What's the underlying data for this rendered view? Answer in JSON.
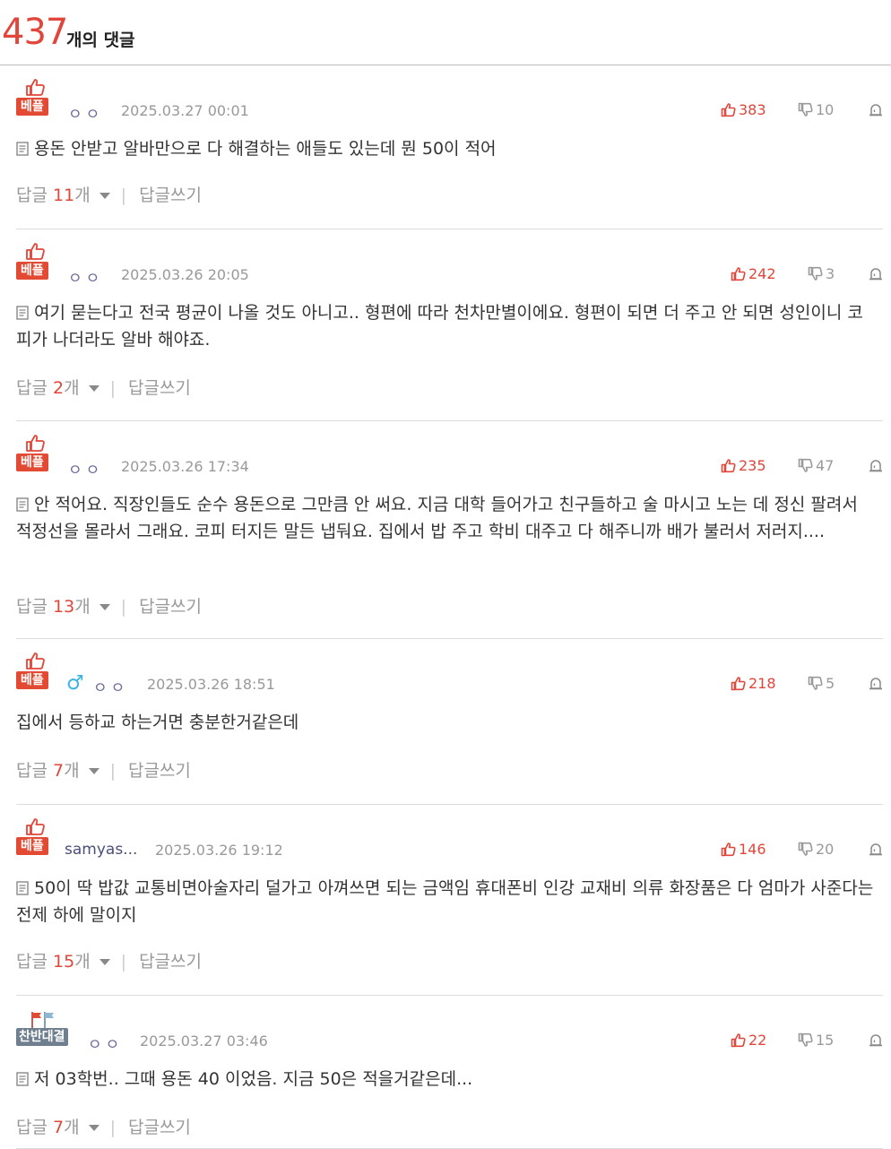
{
  "header": {
    "count": "437",
    "label": "개의 댓글"
  },
  "comments": [
    {
      "badge": "베플",
      "badge_type": "best",
      "thumb_icon": "thumbs-up-badge-icon",
      "gender_icon": "",
      "nick": "ㅇㅇ",
      "date": "2025.03.27 00:01",
      "up": "383",
      "down": "10",
      "has_doc_icon": true,
      "text": "용돈 안받고 알바만으로 다 해결하는 애들도 있는데 뭔 50이 적어",
      "reply_prefix": "답글 ",
      "reply_count": "11",
      "reply_unit": "개",
      "reply_write": "답글쓰기"
    },
    {
      "badge": "베플",
      "badge_type": "best",
      "thumb_icon": "thumbs-up-badge-icon",
      "gender_icon": "",
      "nick": "ㅇㅇ",
      "date": "2025.03.26 20:05",
      "up": "242",
      "down": "3",
      "has_doc_icon": true,
      "text": "여기 묻는다고 전국 평균이 나올 것도 아니고.. 형편에 따라 천차만별이에요. 형편이 되면 더 주고 안 되면 성인이니 코피가 나더라도 알바 해야죠.",
      "reply_prefix": "답글 ",
      "reply_count": "2",
      "reply_unit": "개",
      "reply_write": "답글쓰기"
    },
    {
      "badge": "베플",
      "badge_type": "best",
      "thumb_icon": "thumbs-up-badge-icon",
      "gender_icon": "",
      "nick": "ㅇㅇ",
      "date": "2025.03.26 17:34",
      "up": "235",
      "down": "47",
      "has_doc_icon": true,
      "text": "안 적어요. 직장인들도 순수 용돈으로 그만큼 안 써요. 지금 대학 들어가고 친구들하고 술 마시고 노는 데 정신 팔려서 적정선을 몰라서 그래요. 코피 터지든 말든 냅둬요. 집에서 밥 주고 학비 대주고 다 해주니까 배가 불러서 저러지....",
      "reply_prefix": "답글 ",
      "reply_count": "13",
      "reply_unit": "개",
      "reply_write": "답글쓰기"
    },
    {
      "badge": "베플",
      "badge_type": "best",
      "thumb_icon": "thumbs-up-badge-icon",
      "gender_icon": "♂",
      "nick": "ㅇㅇ",
      "date": "2025.03.26 18:51",
      "up": "218",
      "down": "5",
      "has_doc_icon": false,
      "text": "집에서 등하교 하는거면 충분한거같은데",
      "reply_prefix": "답글 ",
      "reply_count": "7",
      "reply_unit": "개",
      "reply_write": "답글쓰기"
    },
    {
      "badge": "베플",
      "badge_type": "best",
      "thumb_icon": "thumbs-up-badge-icon",
      "gender_icon": "",
      "nick": "samyas...",
      "date": "2025.03.26 19:12",
      "up": "146",
      "down": "20",
      "has_doc_icon": true,
      "text": "50이 딱 밥값 교통비면아술자리 덜가고 아껴쓰면 되는 금액임 휴대폰비 인강 교재비 의류 화장품은 다 엄마가 사준다는 전제 하에 말이지",
      "reply_prefix": "답글 ",
      "reply_count": "15",
      "reply_unit": "개",
      "reply_write": "답글쓰기"
    },
    {
      "badge": "찬반대결",
      "badge_type": "versus",
      "thumb_icon": "flags-icon",
      "gender_icon": "",
      "nick": "ㅇㅇ",
      "date": "2025.03.27 03:46",
      "up": "22",
      "down": "15",
      "has_doc_icon": true,
      "text": "저 03학번.. 그때 용돈 40 이었음. 지금 50은 적을거같은데...",
      "reply_prefix": "답글 ",
      "reply_count": "7",
      "reply_unit": "개",
      "reply_write": "답글쓰기"
    }
  ],
  "colors": {
    "accent": "#e0463a",
    "badge_best": "#e34a33",
    "badge_versus": "#6f7f8f",
    "gender": "#3ab3e0"
  }
}
